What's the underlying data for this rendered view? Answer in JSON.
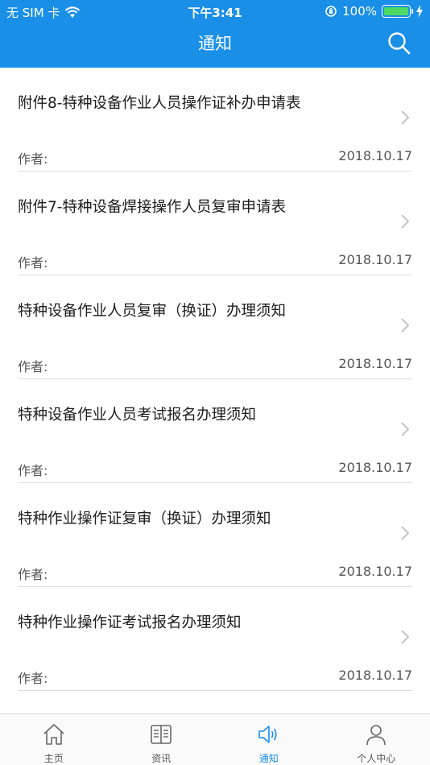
{
  "status_bar": {
    "carrier": "无 SIM 卡",
    "time": "下午3:41",
    "battery": "100%"
  },
  "header": {
    "title": "通知"
  },
  "notices": [
    {
      "title": "附件8-特种设备作业人员操作证补办申请表",
      "author": "作者:",
      "date": "2018.10.17"
    },
    {
      "title": "附件7-特种设备焊接操作人员复审申请表",
      "author": "作者:",
      "date": "2018.10.17"
    },
    {
      "title": "特种设备作业人员复审（换证）办理须知",
      "author": "作者:",
      "date": "2018.10.17"
    },
    {
      "title": "特种设备作业人员考试报名办理须知",
      "author": "作者:",
      "date": "2018.10.17"
    },
    {
      "title": "特种作业操作证复审（换证）办理须知",
      "author": "作者:",
      "date": "2018.10.17"
    },
    {
      "title": "特种作业操作证考试报名办理须知",
      "author": "作者:",
      "date": "2018.10.17"
    }
  ],
  "tabbar": {
    "tabs": [
      {
        "label": "主页",
        "icon": "home-icon"
      },
      {
        "label": "资讯",
        "icon": "book-icon"
      },
      {
        "label": "通知",
        "icon": "speaker-icon"
      },
      {
        "label": "个人中心",
        "icon": "person-icon"
      }
    ],
    "active_color": "#1a8fe8",
    "inactive_color": "#555555"
  },
  "colors": {
    "brand": "#1a8fe8",
    "battery": "#4cd964"
  }
}
